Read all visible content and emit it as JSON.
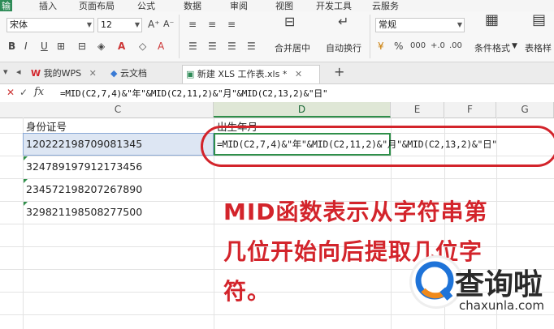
{
  "menu": {
    "items": [
      "输",
      "插入",
      "页面布局",
      "公式",
      "数据",
      "审阅",
      "视图",
      "开发工具",
      "云服务"
    ]
  },
  "ribbon": {
    "font_name": "宋体",
    "font_size": "12",
    "number_format": "常规",
    "merge_label": "合并居中",
    "wrap_label": "自动换行",
    "cond_format_label": "条件格式",
    "table_style_label": "表格样"
  },
  "doc_tabs": [
    {
      "label": "我的WPS",
      "icon": "wps-icon"
    },
    {
      "label": "云文档",
      "icon": "cloud-doc-icon"
    },
    {
      "label": "新建 XLS 工作表.xls *",
      "icon": "sheet-icon"
    }
  ],
  "formula_bar": {
    "fx_label": "fx",
    "formula": "=MID(C2,7,4)&\"年\"&MID(C2,11,2)&\"月\"&MID(C2,13,2)&\"日\""
  },
  "columns": [
    "C",
    "D",
    "E",
    "F",
    "G"
  ],
  "cells": {
    "c1": "身份证号",
    "d1": "出生年月",
    "d2": "=MID(C2,7,4)&\"年\"&MID(C2,11,2)&\"月\"&MID(C2,13,2)&\"日\"",
    "c_values": [
      "120222198709081345",
      "324789197912173456",
      "234572198207267890",
      "329821198508277500"
    ]
  },
  "annotation": {
    "lines": [
      "MID函数表示从字符串第",
      "几位开始向后提取几位字",
      "符。"
    ]
  },
  "logo": {
    "name": "查询啦",
    "domain": "chaxunla.com"
  },
  "colors": {
    "accent_red": "#d3242b",
    "wps_green": "#2e8b57"
  }
}
